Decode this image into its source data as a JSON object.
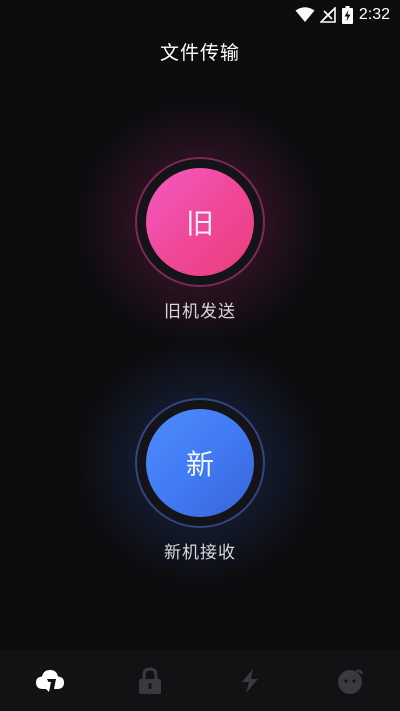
{
  "status_bar": {
    "time": "2:32"
  },
  "header": {
    "title": "文件传输"
  },
  "old_device": {
    "symbol": "旧",
    "label": "旧机发送",
    "accent": "#f0489a"
  },
  "new_device": {
    "symbol": "新",
    "label": "新机接收",
    "accent": "#4079f2"
  },
  "bottom_nav": {
    "items": [
      {
        "icon": "cloud-upload-icon",
        "active": true
      },
      {
        "icon": "lock-icon",
        "active": false
      },
      {
        "icon": "lightning-icon",
        "active": false
      },
      {
        "icon": "smiley-icon",
        "active": false
      }
    ],
    "active_color": "#ffffff",
    "inactive_color": "#3a3a3e"
  }
}
